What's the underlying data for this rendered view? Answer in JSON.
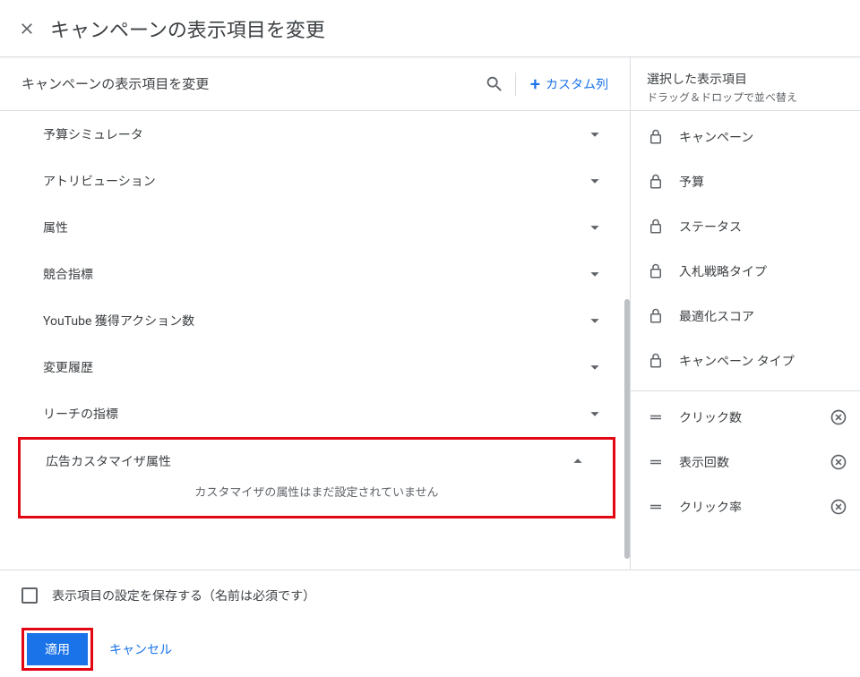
{
  "header": {
    "title": "キャンペーンの表示項目を変更"
  },
  "search": {
    "label": "キャンペーンの表示項目を変更",
    "custom_column": "カスタム列"
  },
  "categories": [
    {
      "label": "予算シミュレータ"
    },
    {
      "label": "アトリビューション"
    },
    {
      "label": "属性"
    },
    {
      "label": "競合指標"
    },
    {
      "label": "YouTube 獲得アクション数"
    },
    {
      "label": "変更履歴"
    },
    {
      "label": "リーチの指標"
    }
  ],
  "expanded": {
    "label": "広告カスタマイザ属性",
    "empty_message": "カスタマイザの属性はまだ設定されていません"
  },
  "right": {
    "title": "選択した表示項目",
    "subtitle": "ドラッグ＆ドロップで並べ替え",
    "locked": [
      {
        "label": "キャンペーン"
      },
      {
        "label": "予算"
      },
      {
        "label": "ステータス"
      },
      {
        "label": "入札戦略タイプ"
      },
      {
        "label": "最適化スコア"
      },
      {
        "label": "キャンペーン タイプ"
      }
    ],
    "removable": [
      {
        "label": "クリック数"
      },
      {
        "label": "表示回数"
      },
      {
        "label": "クリック率"
      }
    ]
  },
  "footer": {
    "save_label": "表示項目の設定を保存する（名前は必須です）",
    "apply": "適用",
    "cancel": "キャンセル"
  }
}
